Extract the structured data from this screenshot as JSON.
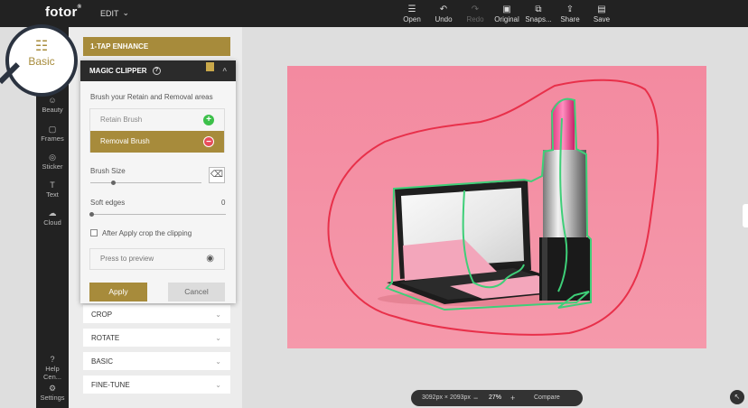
{
  "app": {
    "logo": "fotor",
    "logo_mark": "®",
    "menu": "EDIT"
  },
  "toolbar": [
    {
      "label": "Open",
      "icon": "menu-icon",
      "glyph": "☰",
      "enabled": true
    },
    {
      "label": "Undo",
      "icon": "undo-icon",
      "glyph": "↶",
      "enabled": true
    },
    {
      "label": "Redo",
      "icon": "redo-icon",
      "glyph": "↷",
      "enabled": false
    },
    {
      "label": "Original",
      "icon": "original-icon",
      "glyph": "▣",
      "enabled": true
    },
    {
      "label": "Snaps...",
      "icon": "snapshot-icon",
      "glyph": "⧉",
      "enabled": true
    },
    {
      "label": "Share",
      "icon": "share-icon",
      "glyph": "⇪",
      "enabled": true
    },
    {
      "label": "Save",
      "icon": "save-icon",
      "glyph": "▤",
      "enabled": true
    }
  ],
  "nav": {
    "active": "Basic",
    "items": [
      {
        "label": "Beauty",
        "icon": "beauty-icon",
        "glyph": "☺"
      },
      {
        "label": "Frames",
        "icon": "frames-icon",
        "glyph": "▢"
      },
      {
        "label": "Sticker",
        "icon": "sticker-icon",
        "glyph": "◎"
      },
      {
        "label": "Text",
        "icon": "text-icon",
        "glyph": "T"
      },
      {
        "label": "Cloud",
        "icon": "cloud-icon",
        "glyph": "☁"
      }
    ],
    "bottom": [
      {
        "label": "Help Cen...",
        "icon": "help-icon",
        "glyph": "?"
      },
      {
        "label": "Settings",
        "icon": "settings-icon",
        "glyph": "⚙"
      }
    ]
  },
  "panel": {
    "enhance": "1-TAP ENHANCE",
    "sections": [
      "CROP",
      "ROTATE",
      "BASIC",
      "FINE-TUNE"
    ]
  },
  "clipper": {
    "title": "MAGIC CLIPPER",
    "instruction": "Brush your Retain and Removal areas",
    "retain_brush": "Retain Brush",
    "removal_brush": "Removal Brush",
    "brush_size_label": "Brush Size",
    "brush_size_value": 0.2,
    "soft_edges_label": "Soft edges",
    "soft_edges_value": "0",
    "after_apply_label": "After Apply crop the clipping",
    "after_apply_checked": false,
    "preview_label": "Press to preview",
    "apply_label": "Apply",
    "cancel_label": "Cancel"
  },
  "status": {
    "dimensions": "3092px × 2093px",
    "zoom_out": "−",
    "zoom": "27%",
    "zoom_in": "+",
    "compare": "Compare"
  },
  "colors": {
    "accent": "#a78b3b",
    "dark": "#222222",
    "photo_bg": "#f48aa0",
    "removal_stroke": "#e8304a",
    "retain_stroke": "#3ecf78"
  }
}
